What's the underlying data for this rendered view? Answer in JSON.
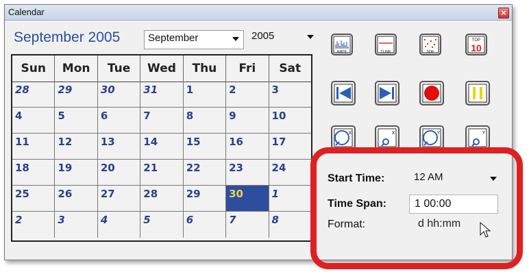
{
  "window": {
    "title": "Calendar",
    "close_label": "×"
  },
  "header": {
    "month_title": "September 2005",
    "month_select": "September",
    "year_select": "2005"
  },
  "calendar": {
    "days": [
      "Sun",
      "Mon",
      "Tue",
      "Wed",
      "Thu",
      "Fri",
      "Sat"
    ],
    "weeks": [
      [
        {
          "d": "28",
          "other": true
        },
        {
          "d": "29",
          "other": true
        },
        {
          "d": "30",
          "other": true
        },
        {
          "d": "31",
          "other": true
        },
        {
          "d": "1"
        },
        {
          "d": "2"
        },
        {
          "d": "3"
        }
      ],
      [
        {
          "d": "4"
        },
        {
          "d": "5"
        },
        {
          "d": "6"
        },
        {
          "d": "7"
        },
        {
          "d": "8"
        },
        {
          "d": "9"
        },
        {
          "d": "10"
        }
      ],
      [
        {
          "d": "11"
        },
        {
          "d": "12"
        },
        {
          "d": "13"
        },
        {
          "d": "14"
        },
        {
          "d": "15"
        },
        {
          "d": "16"
        },
        {
          "d": "17"
        }
      ],
      [
        {
          "d": "18"
        },
        {
          "d": "19"
        },
        {
          "d": "20"
        },
        {
          "d": "21"
        },
        {
          "d": "22"
        },
        {
          "d": "23"
        },
        {
          "d": "24"
        }
      ],
      [
        {
          "d": "25"
        },
        {
          "d": "26"
        },
        {
          "d": "27"
        },
        {
          "d": "28"
        },
        {
          "d": "29"
        },
        {
          "d": "30",
          "selected": true
        },
        {
          "d": "1",
          "other": true
        }
      ],
      [
        {
          "d": "2",
          "other": true
        },
        {
          "d": "3",
          "other": true
        },
        {
          "d": "4",
          "other": true
        },
        {
          "d": "5",
          "other": true
        },
        {
          "d": "6",
          "other": true
        },
        {
          "d": "7",
          "other": true
        },
        {
          "d": "8",
          "other": true
        }
      ]
    ]
  },
  "toolbar": {
    "rate_label": "RATE",
    "tline_label": "TLINE",
    "soe_label": "SOE",
    "top_label": "TOP",
    "top_number": "10"
  },
  "time_panel": {
    "start_time_label": "Start Time:",
    "start_time_value": "12 AM",
    "time_span_label": "Time Span:",
    "time_span_value": "1 00:00",
    "format_label": "Format:",
    "format_value": "d hh:mm"
  },
  "colors": {
    "accent": "#2f4d9e",
    "selected_text": "#e6d44a",
    "highlight": "#e02020",
    "record": "#e01010",
    "pause": "#e6d800"
  }
}
